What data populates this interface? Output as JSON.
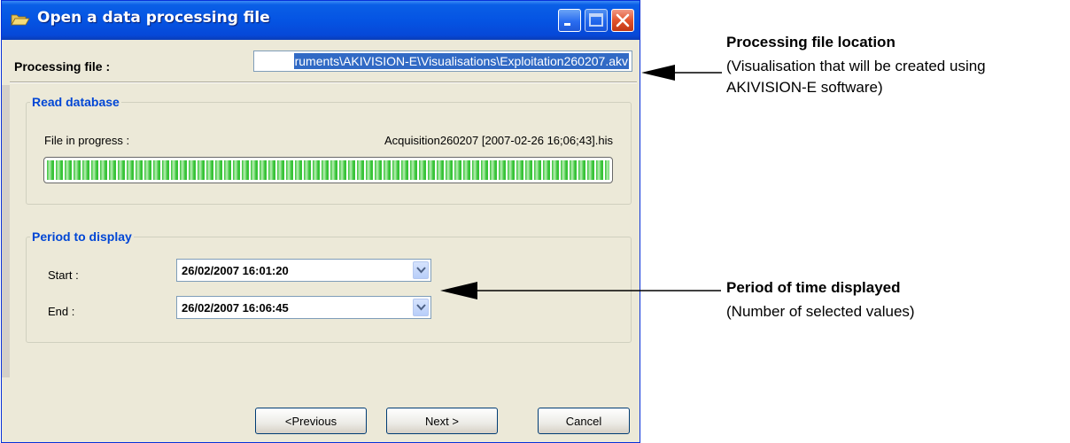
{
  "window": {
    "title": "Open a data processing file",
    "controls": [
      "minimize-icon",
      "maximize-icon",
      "close-icon"
    ]
  },
  "processing_file": {
    "label": "Processing file :",
    "value": "ruments\\AKIVISION-E\\Visualisations\\Exploitation260207.akv"
  },
  "read_database": {
    "legend": "Read database",
    "file_in_progress_label": "File in progress :",
    "file_in_progress_value": "Acquisition260207 [2007-02-26 16;06;43].his",
    "progress_fraction": 1.0
  },
  "period": {
    "legend": "Period to display",
    "start_label": "Start :",
    "start_value": "26/02/2007 16:01:20",
    "end_label": "End :",
    "end_value": "26/02/2007 16:06:45"
  },
  "buttons": {
    "previous": "<Previous",
    "next": "Next >",
    "cancel": "Cancel"
  },
  "annotations": {
    "file_location_title": "Processing file location",
    "file_location_desc_1": "(Visualisation that will be created using",
    "file_location_desc_2": "AKIVISION-E software)",
    "period_title": "Period of time displayed",
    "period_desc": "(Number of selected values)"
  },
  "colors": {
    "titlebar": "#0554e3",
    "group_legend": "#0046d5",
    "progress_green": "#37c337",
    "selection": "#316ac5"
  }
}
